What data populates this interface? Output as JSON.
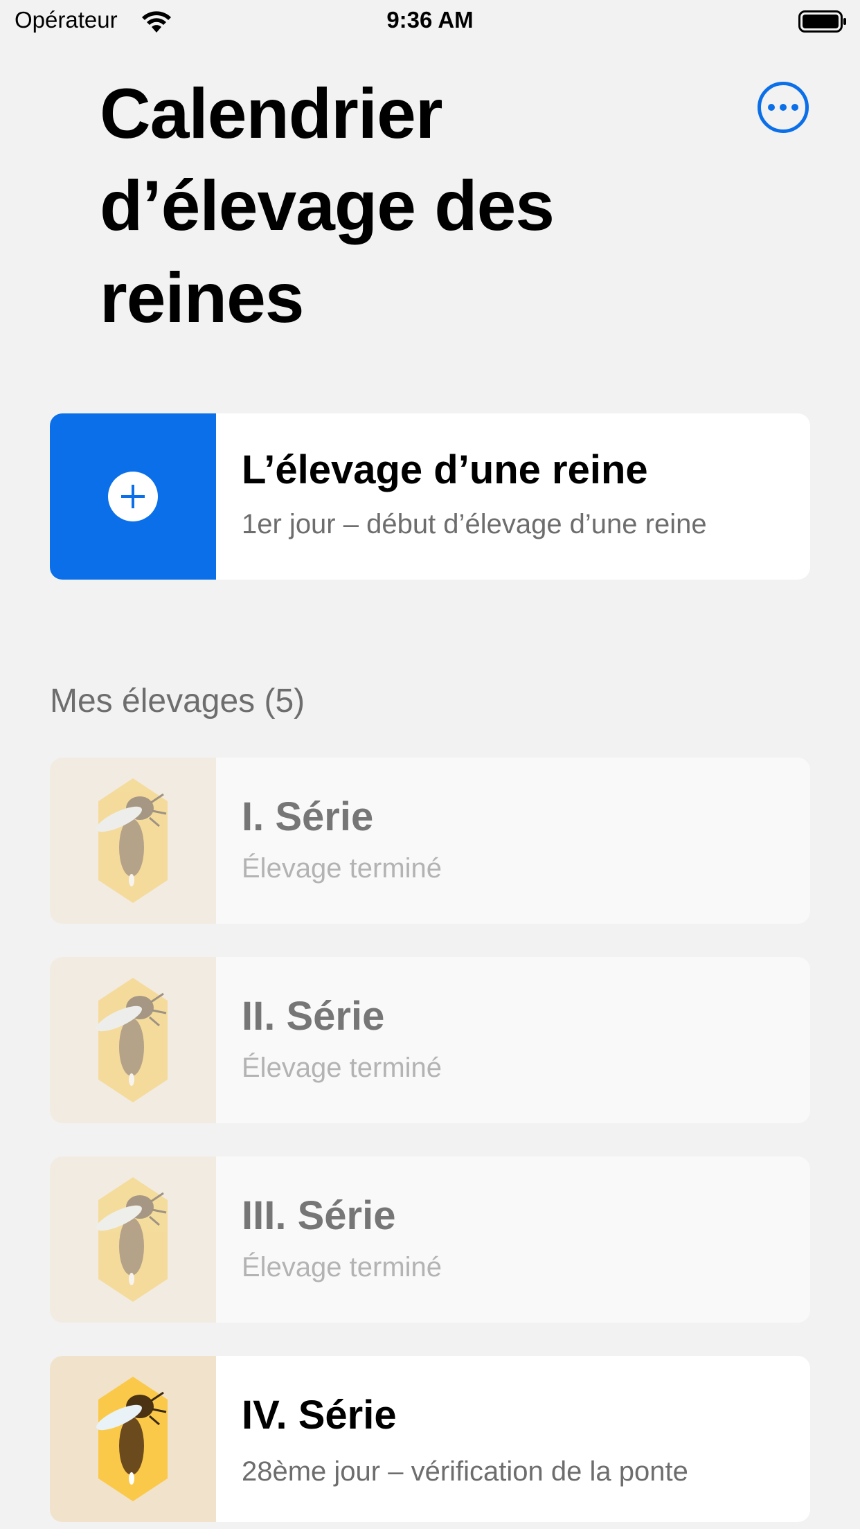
{
  "status_bar": {
    "carrier": "Opérateur",
    "time": "9:36 AM"
  },
  "header": {
    "title": "Calendrier d’élevage des reines",
    "more_icon": "ellipsis-circle-icon"
  },
  "new_breeding": {
    "title": "L’élevage d’une reine",
    "subtitle": "1er jour – début d’élevage d’une reine",
    "icon": "plus-circle-icon"
  },
  "my_breedings": {
    "header": "Mes élevages (5)",
    "items": [
      {
        "title": "I. Série",
        "subtitle": "Élevage terminé",
        "icon": "queen-bee-cell-icon"
      },
      {
        "title": "II. Série",
        "subtitle": "Élevage terminé",
        "icon": "queen-bee-cell-icon"
      },
      {
        "title": "III. Série",
        "subtitle": "Élevage terminé",
        "icon": "queen-bee-cell-icon"
      },
      {
        "title": "IV. Série",
        "subtitle": "28ème jour – vérification de la ponte",
        "icon": "queen-bee-cell-icon"
      }
    ]
  },
  "colors": {
    "accent": "#0a6fe8",
    "background": "#f2f2f2",
    "honey": "#f7c948"
  }
}
